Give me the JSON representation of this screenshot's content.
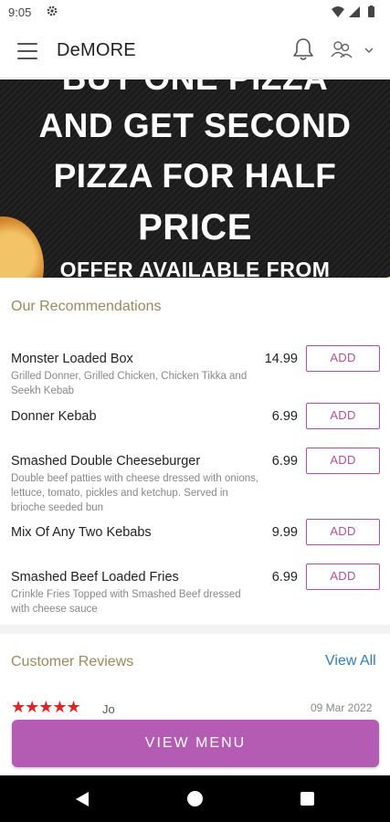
{
  "status_bar": {
    "time": "9:05",
    "icons": [
      "gear-icon",
      "wifi-icon",
      "signal-icon",
      "battery-icon"
    ]
  },
  "app_bar": {
    "title": "DeMORE",
    "icons": [
      "hamburger-menu-icon",
      "bell-icon",
      "account-icon",
      "chevron-down-icon"
    ]
  },
  "banner": {
    "lines": [
      "BUY ONE PIZZA",
      "AND GET SECOND",
      "PIZZA FOR HALF",
      "PRICE",
      "OFFER AVAILABLE FROM"
    ]
  },
  "recommendations": {
    "title": "Our Recommendations",
    "add_label": "ADD",
    "items": [
      {
        "name": "Monster Loaded Box",
        "desc": "Grilled Donner, Grilled Chicken, Chicken Tikka and Seekh Kebab",
        "price": "14.99"
      },
      {
        "name": "Donner Kebab",
        "desc": "",
        "price": "6.99"
      },
      {
        "name": "Smashed Double Cheeseburger",
        "desc": "Double beef patties with cheese dressed with onions, lettuce, tomato, pickles and ketchup. Served in brioche seeded bun",
        "price": "6.99"
      },
      {
        "name": "Mix Of Any Two Kebabs",
        "desc": "",
        "price": "9.99"
      },
      {
        "name": "Smashed Beef Loaded Fries",
        "desc": "Crinkle Fries Topped with Smashed Beef dressed with cheese sauce",
        "price": "6.99"
      }
    ]
  },
  "reviews": {
    "title": "Customer Reviews",
    "view_all": "View All",
    "first": {
      "stars": "★★★★★",
      "rating": 5,
      "name": "Jo",
      "date": "09 Mar 2022"
    }
  },
  "view_menu_label": "VIEW MENU",
  "colors": {
    "accent": "#b45cb3",
    "add_border": "#b4509c",
    "section_title": "#9b8a5a",
    "link": "#2d7fc1",
    "stars": "#e02424"
  }
}
